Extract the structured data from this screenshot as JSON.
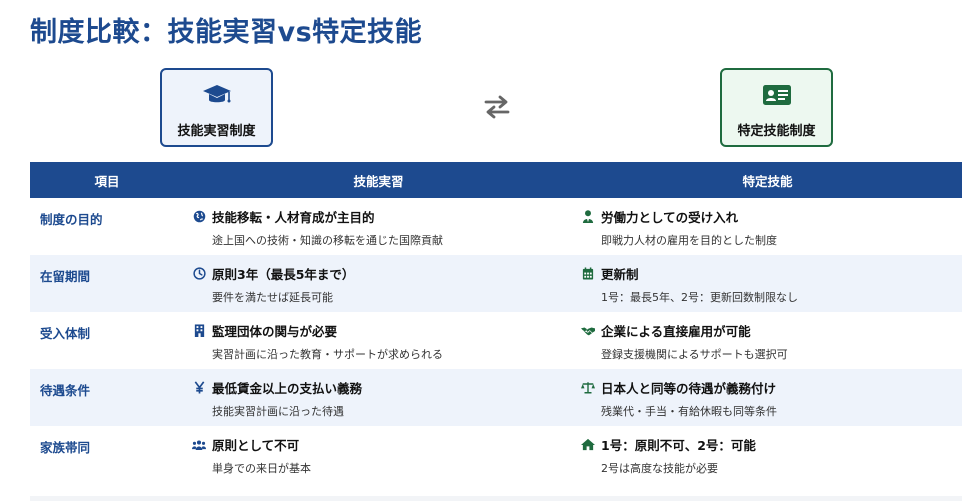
{
  "page": {
    "title": "制度比較：技能実習vs特定技能"
  },
  "cards": {
    "left": {
      "label": "技能実習制度",
      "icon": "graduation-cap-icon"
    },
    "right": {
      "label": "特定技能制度",
      "icon": "id-card-icon"
    },
    "swap_icon": "swap-arrows-icon"
  },
  "table": {
    "headers": [
      "項目",
      "技能実習",
      "特定技能"
    ],
    "rows": [
      {
        "label": "制度の目的",
        "tech": {
          "icon": "globe-icon",
          "main": "技能移転・人材育成が主目的",
          "sub": "途上国への技術・知識の移転を通じた国際貢献"
        },
        "spec": {
          "icon": "user-tie-icon",
          "main": "労働力としての受け入れ",
          "sub": "即戦力人材の雇用を目的とした制度"
        }
      },
      {
        "label": "在留期間",
        "tech": {
          "icon": "clock-icon",
          "main": "原則3年（最長5年まで）",
          "sub": "要件を満たせば延長可能"
        },
        "spec": {
          "icon": "calendar-icon",
          "main": "更新制",
          "sub": "1号：最長5年、2号：更新回数制限なし"
        }
      },
      {
        "label": "受入体制",
        "tech": {
          "icon": "building-icon",
          "main": "監理団体の関与が必要",
          "sub": "実習計画に沿った教育・サポートが求められる"
        },
        "spec": {
          "icon": "handshake-icon",
          "main": "企業による直接雇用が可能",
          "sub": "登録支援機関によるサポートも選択可"
        }
      },
      {
        "label": "待遇条件",
        "tech": {
          "icon": "yen-icon",
          "main": "最低賃金以上の支払い義務",
          "sub": "技能実習計画に沿った待遇"
        },
        "spec": {
          "icon": "scale-icon",
          "main": "日本人と同等の待遇が義務付け",
          "sub": "残業代・手当・有給休暇も同等条件"
        }
      },
      {
        "label": "家族帯同",
        "tech": {
          "icon": "users-icon",
          "main": "原則として不可",
          "sub": "単身での来日が基本"
        },
        "spec": {
          "icon": "home-icon",
          "main": "1号：原則不可、2号：可能",
          "sub": "2号は高度な技能が必要"
        }
      }
    ]
  },
  "colors": {
    "tech_accent": "#1d4a8f",
    "spec_accent": "#1f6b3f",
    "header_bg": "#1d4a8f",
    "row_alt_bg": "#eef3fb"
  }
}
